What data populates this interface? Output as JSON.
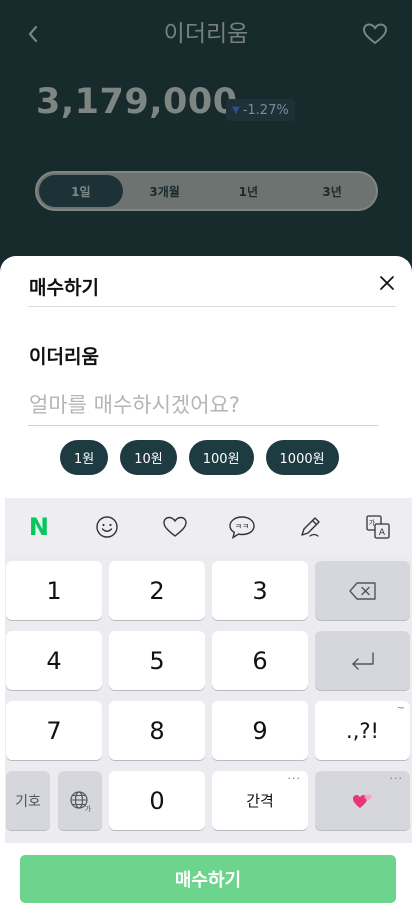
{
  "header": {
    "title": "이더리움",
    "price": "3,179,000",
    "change": "-1.27%",
    "change_arrow": "▼",
    "period_tabs": [
      "1일",
      "3개월",
      "1년",
      "3년"
    ],
    "active_tab": "1일"
  },
  "sheet": {
    "title": "매수하기",
    "coin_name": "이더리움",
    "amount_placeholder": "얼마를 매수하시겠어요?",
    "amount_value": "",
    "quick_amounts": [
      "1원",
      "10원",
      "100원",
      "1000원"
    ]
  },
  "keyboard": {
    "toolbar": [
      "naver-n-icon",
      "emoji-icon",
      "heart-icon",
      "chat-kk-icon",
      "pen-icon",
      "translate-icon"
    ],
    "naver_label": "N",
    "keys": {
      "k1": "1",
      "k2": "2",
      "k3": "3",
      "k4": "4",
      "k5": "5",
      "k6": "6",
      "k7": "7",
      "k8": "8",
      "k9": "9",
      "k0": "0",
      "punct": ".,?!",
      "symbols": "기호",
      "space": "간격",
      "dots": "···",
      "tilde": "~"
    }
  },
  "cta": {
    "label": "매수하기"
  },
  "colors": {
    "accent_green": "#6dd48e",
    "chip_dark": "#1d3b40",
    "naver_green": "#03c75a"
  }
}
